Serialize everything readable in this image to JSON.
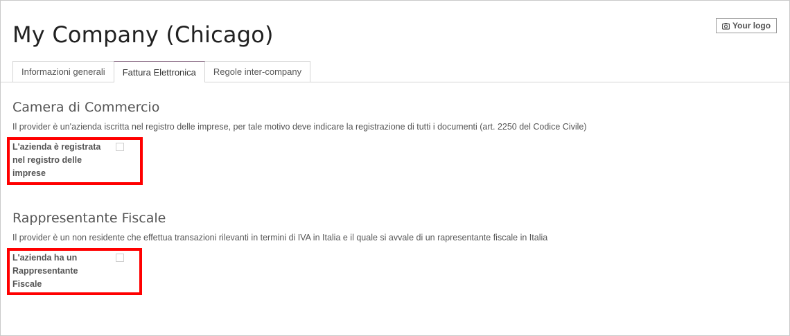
{
  "page": {
    "title": "My Company (Chicago)",
    "logo_button_label": "Your logo",
    "logo_icon": "camera-icon"
  },
  "tabs": [
    {
      "label": "Informazioni generali",
      "active": false
    },
    {
      "label": "Fattura Elettronica",
      "active": true
    },
    {
      "label": "Regole inter-company",
      "active": false
    }
  ],
  "sections": {
    "camera": {
      "title": "Camera di Commercio",
      "description": "Il provider è un'azienda iscritta nel registro delle imprese, per tale motivo deve indicare la registrazione di tutti i documenti (art. 2250 del Codice Civile)",
      "field_label_lines": [
        "L'azienda è registrata",
        "nel registro delle",
        "imprese"
      ],
      "checked": false
    },
    "rappresentante": {
      "title": "Rappresentante Fiscale",
      "description": "Il provider è un non residente che effettua transazioni rilevanti in termini di IVA in Italia e il quale si avvale di un rapresentante fiscale in Italia",
      "field_label_lines": [
        "L'azienda ha un",
        "Rappresentante",
        "Fiscale"
      ],
      "checked": false
    }
  },
  "colors": {
    "highlight": "#ff0000",
    "active_tab_accent": "#7c5a77"
  }
}
